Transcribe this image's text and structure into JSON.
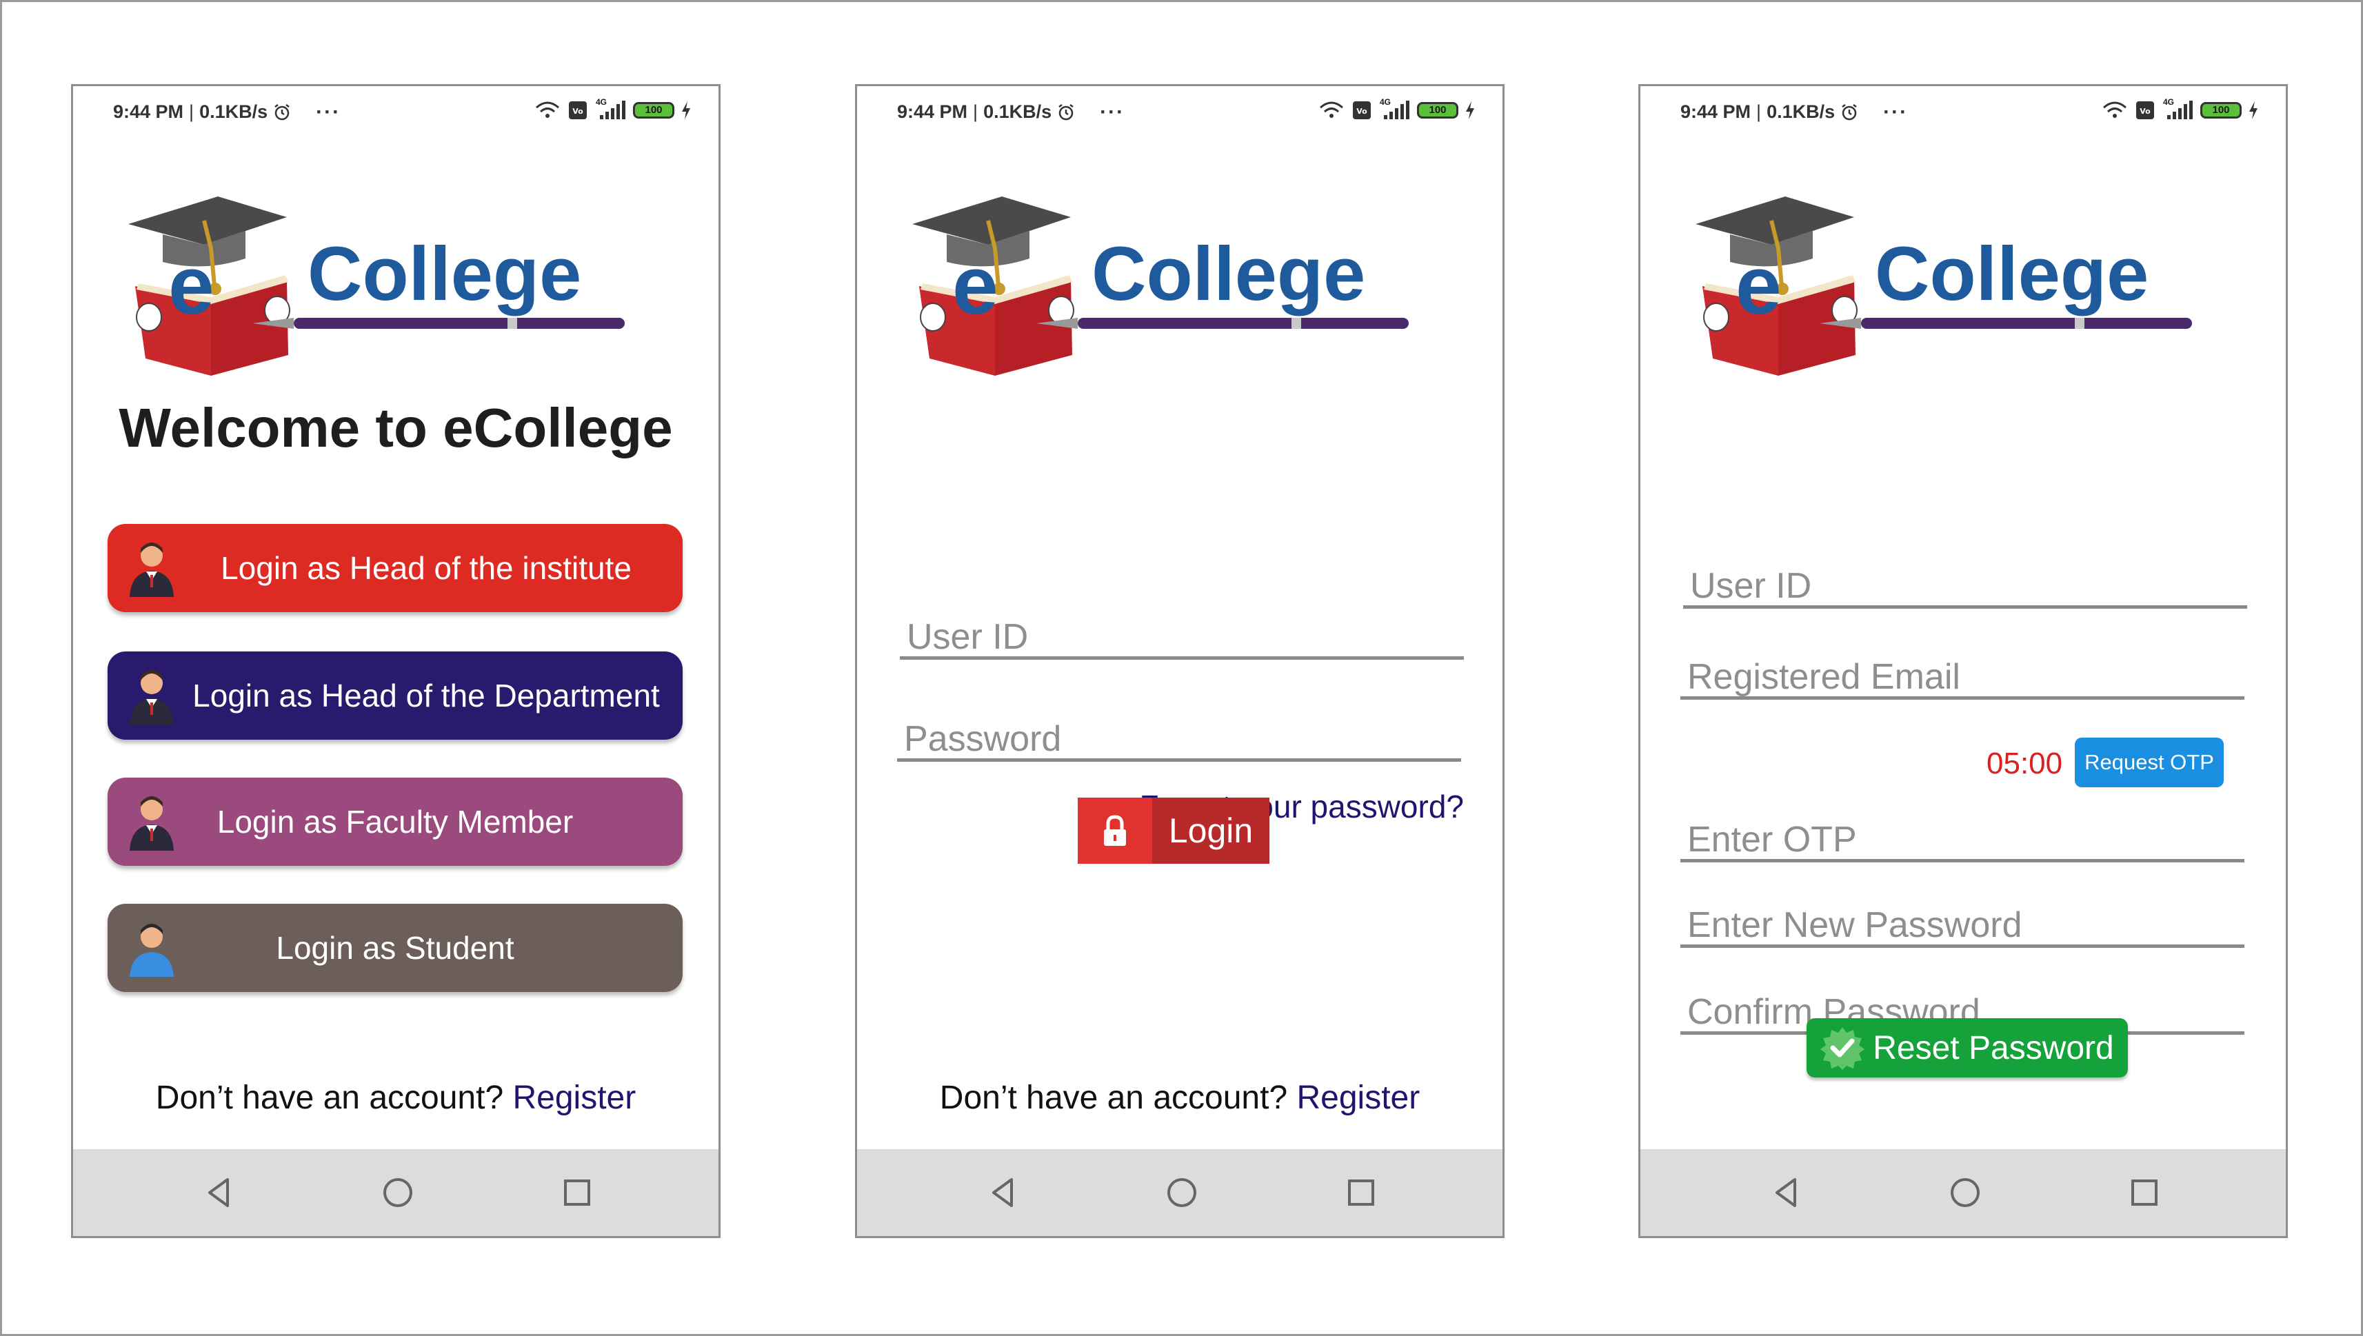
{
  "status_bar": {
    "time": "9:44 PM",
    "separator": "|",
    "speed": "0.1KB/s",
    "more": "···",
    "network": "4G",
    "battery": "100"
  },
  "logo": {
    "brand_prefix": "e",
    "brand_name": "College",
    "colors": {
      "blue": "#1e5a9c",
      "book_red": "#c9282d",
      "pen_purple": "#4b2a6b"
    }
  },
  "screen_home": {
    "title": "Welcome to eCollege",
    "buttons": [
      {
        "label": "Login as Head of the institute",
        "color": "#dd2b24",
        "icon": "head-of-institute-avatar-icon"
      },
      {
        "label": "Login as Head of the Department",
        "color": "#2a1a6e",
        "icon": "head-of-department-avatar-icon"
      },
      {
        "label": "Login as Faculty Member",
        "color": "#9a4a7d",
        "icon": "faculty-avatar-icon"
      },
      {
        "label": "Login as Student",
        "color": "#6c5f59",
        "icon": "student-avatar-icon"
      }
    ],
    "register_prompt": "Don’t have an account?",
    "register_link": "Register"
  },
  "screen_login": {
    "user_id_placeholder": "User ID",
    "password_placeholder": "Password",
    "forgot_link": "Forgot your password?",
    "login_label": "Login",
    "register_prompt": "Don’t have an account?",
    "register_link": "Register"
  },
  "screen_reset": {
    "user_id_placeholder": "User ID",
    "email_placeholder": "Registered Email",
    "otp_timer": "05:00",
    "request_otp_label": "Request OTP",
    "otp_placeholder": "Enter OTP",
    "new_password_placeholder": "Enter New Password",
    "confirm_password_placeholder": "Confirm Password",
    "reset_label": "Reset Password"
  },
  "nav": {
    "icons": [
      "back-icon",
      "home-icon",
      "recents-icon"
    ]
  }
}
